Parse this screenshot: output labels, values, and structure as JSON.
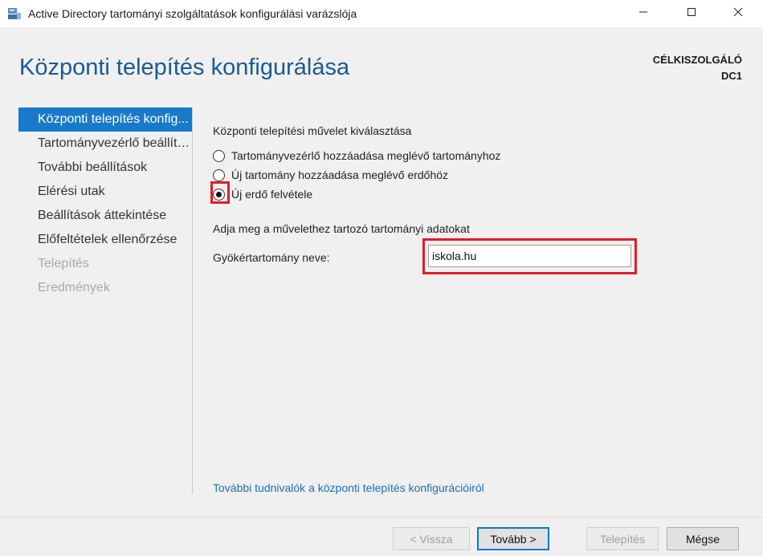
{
  "window": {
    "title": "Active Directory tartományi szolgáltatások konfigurálási varázslója"
  },
  "header": {
    "page_title": "Központi telepítés konfigurálása",
    "target_label": "CÉLKISZOLGÁLÓ",
    "target_name": "DC1"
  },
  "nav": {
    "items": [
      {
        "label": "Központi telepítés konfig...",
        "state": "active"
      },
      {
        "label": "Tartományvezérlő beállítá...",
        "state": "normal"
      },
      {
        "label": "További beállítások",
        "state": "normal"
      },
      {
        "label": "Elérési utak",
        "state": "normal"
      },
      {
        "label": "Beállítások áttekintése",
        "state": "normal"
      },
      {
        "label": "Előfeltételek ellenőrzése",
        "state": "normal"
      },
      {
        "label": "Telepítés",
        "state": "disabled"
      },
      {
        "label": "Eredmények",
        "state": "disabled"
      }
    ]
  },
  "content": {
    "operation_heading": "Központi telepítési művelet kiválasztása",
    "options": [
      {
        "label": "Tartományvezérlő hozzáadása meglévő tartományhoz",
        "checked": false
      },
      {
        "label": "Új tartomány hozzáadása meglévő erdőhöz",
        "checked": false
      },
      {
        "label": "Új erdő felvétele",
        "checked": true
      }
    ],
    "domain_heading": "Adja meg a művelethez tartozó tartományi adatokat",
    "root_domain_label": "Gyökértartomány neve:",
    "root_domain_value": "iskola.hu",
    "help_link": "További tudnivalók a központi telepítés konfigurációiról"
  },
  "buttons": {
    "back": "< Vissza",
    "next": "Tovább >",
    "install": "Telepítés",
    "cancel": "Mégse"
  },
  "colors": {
    "accent": "#1979ca",
    "title": "#1a5a8f",
    "highlight": "#e31c25",
    "link": "#1a6fb5"
  }
}
